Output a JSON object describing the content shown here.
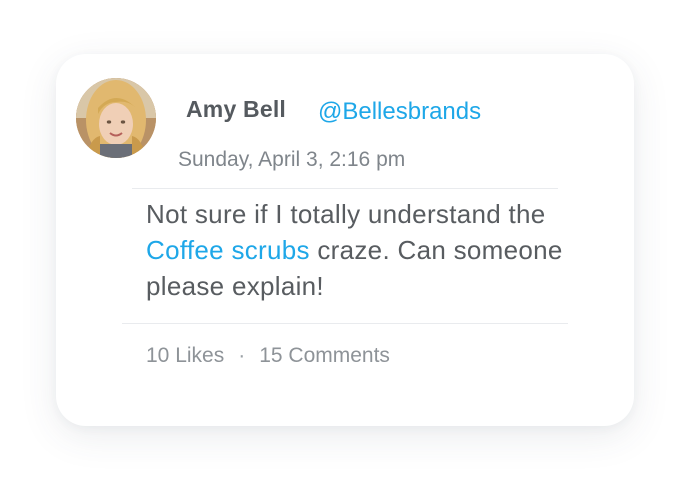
{
  "post": {
    "author_name": "Amy Bell",
    "author_handle": "@Bellesbrands",
    "timestamp": "Sunday, April 3, 2:16 pm",
    "text_before": "Not sure if I totally understand the ",
    "text_link": "Coffee scrubs",
    "text_after": " craze. Can someone please explain!",
    "likes": "10 Likes",
    "separator": "·",
    "comments": "15 Comments"
  },
  "colors": {
    "accent": "#1ea7e8",
    "text": "#585c60",
    "muted": "#8e9398"
  }
}
